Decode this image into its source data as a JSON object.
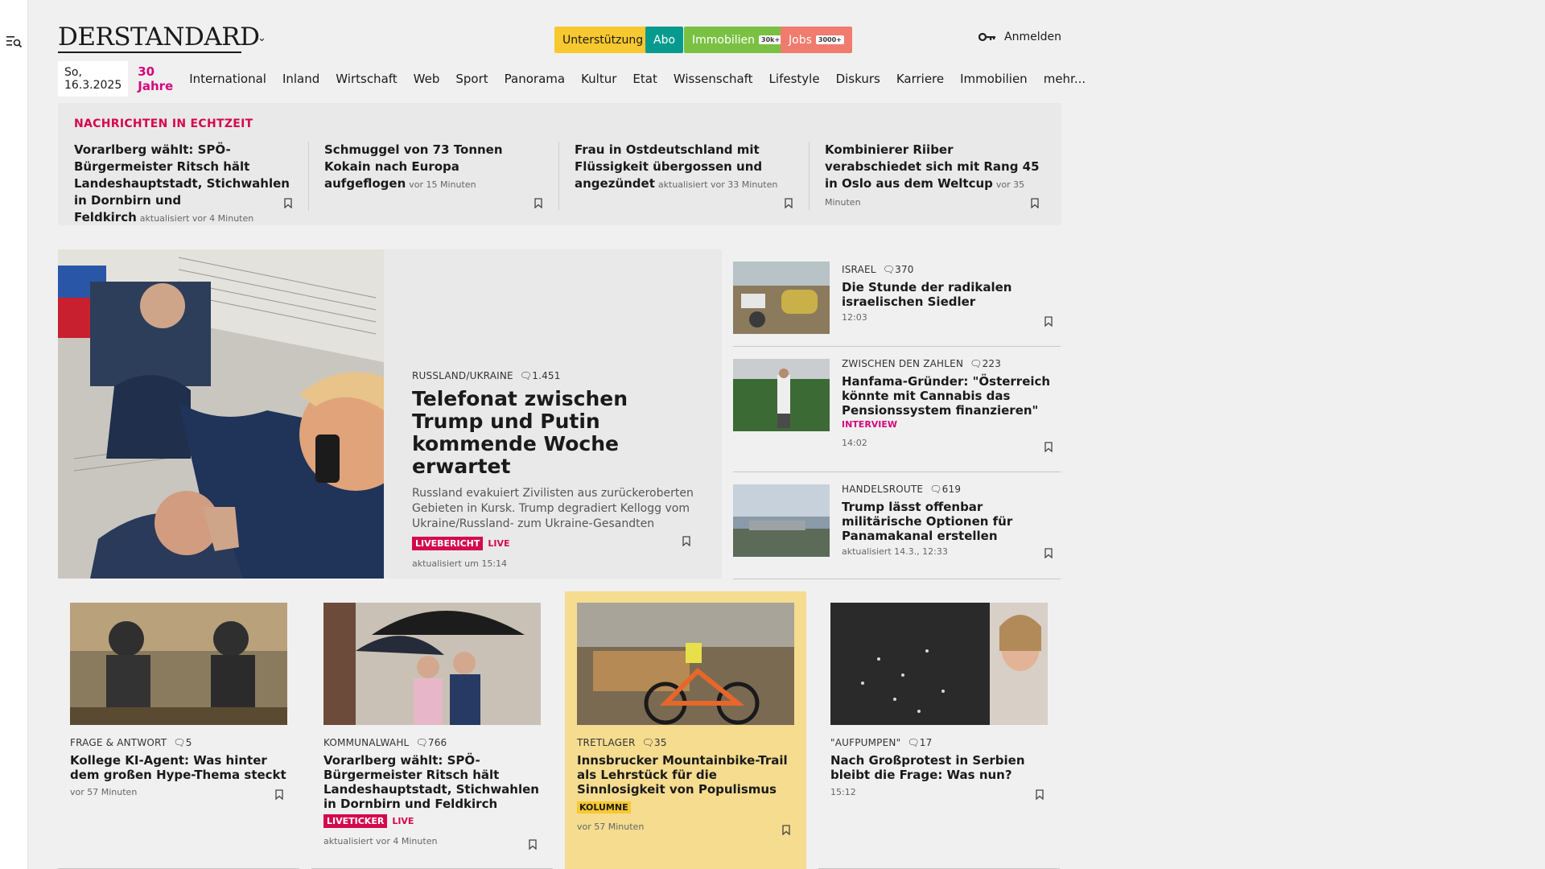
{
  "header": {
    "logo": "DERSTANDARD",
    "promos": [
      {
        "label": "Unterstützung",
        "badge": "",
        "bg": "#f7c82f",
        "fg": "#1a1a1a"
      },
      {
        "label": "Abo",
        "badge": "",
        "bg": "#069a8e",
        "fg": "#ffffff"
      },
      {
        "label": "Immobilien",
        "badge": "30k+",
        "bg": "#7ac143",
        "fg": "#ffffff"
      },
      {
        "label": "Jobs",
        "badge": "3000+",
        "bg": "#f07b6e",
        "fg": "#ffffff"
      }
    ],
    "login": "Anmelden"
  },
  "nav": {
    "date": "So, 16.3.2025",
    "items": [
      "30 Jahre",
      "International",
      "Inland",
      "Wirtschaft",
      "Web",
      "Sport",
      "Panorama",
      "Kultur",
      "Etat",
      "Wissenschaft",
      "Lifestyle",
      "Diskurs",
      "Karriere",
      "Immobilien",
      "mehr..."
    ]
  },
  "ticker": {
    "title": "NACHRICHTEN IN ECHTZEIT",
    "items": [
      {
        "title": "Vorarlberg wählt: SPÖ-Bürgermeister Ritsch hält Landeshauptstadt, Stichwahlen in Dornbirn und Feldkirch",
        "meta": "aktualisiert vor 4 Minuten"
      },
      {
        "title": "Schmuggel von 73 Tonnen Kokain nach Europa aufgeflogen",
        "meta": "vor 15 Minuten"
      },
      {
        "title": "Frau in Ostdeutschland mit Flüssigkeit übergossen und angezündet",
        "meta": "aktualisiert vor 33 Minuten"
      },
      {
        "title": "Kombinierer Riiber verabschiedet sich mit Rang 45 in Oslo aus dem Weltcup",
        "meta": "vor 35 Minuten"
      }
    ]
  },
  "lead": {
    "kicker": "RUSSLAND/UKRAINE",
    "comments": "1.451",
    "title": "Telefonat zwischen Trump und Putin kommende Woche erwartet",
    "summary": "Russland evakuiert Zivilisten aus zurückeroberten Gebieten in Kursk. Trump degradiert Kellogg vom Ukraine/Russland- zum Ukraine-Gesandten",
    "tag": "LIVEBERICHT",
    "live": "LIVE",
    "time": "aktualisiert um 15:14"
  },
  "side": [
    {
      "kicker": "ISRAEL",
      "comments": "370",
      "title": "Die Stunde der radikalen israelischen Siedler",
      "extra": "",
      "time": "12:03"
    },
    {
      "kicker": "ZWISCHEN DEN ZAHLEN",
      "comments": "223",
      "title": "Hanfama-Gründer: \"Österreich könnte mit Cannabis das Pensionssystem finanzieren\"",
      "extra": "INTERVIEW",
      "time": "14:02"
    },
    {
      "kicker": "HANDELSROUTE",
      "comments": "619",
      "title": "Trump lässt offenbar militärische Optionen für Panamakanal erstellen",
      "extra": "",
      "time": "aktualisiert 14.3., 12:33"
    }
  ],
  "cards": [
    {
      "kicker": "FRAGE & ANTWORT",
      "comments": "5",
      "title": "Kollege KI-Agent: Was hinter dem großen Hype-Thema steckt",
      "tag": "",
      "live": "",
      "kolumne": "",
      "time": "vor 57 Minuten"
    },
    {
      "kicker": "KOMMUNALWAHL",
      "comments": "766",
      "title": "Vorarlberg wählt: SPÖ-Bürgermeister Ritsch hält Landeshauptstadt, Stichwahlen in Dornbirn und Feldkirch",
      "tag": "LIVETICKER",
      "live": "LIVE",
      "kolumne": "",
      "time": "aktualisiert vor 4 Minuten"
    },
    {
      "kicker": "TRETLAGER",
      "comments": "35",
      "title": "Innsbrucker Mountainbike-Trail als Lehrstück für die Sinnlosigkeit von Populismus",
      "tag": "",
      "live": "",
      "kolumne": "KOLUMNE",
      "time": "vor 57 Minuten"
    },
    {
      "kicker": "\"AUFPUMPEN\"",
      "comments": "17",
      "title": "Nach Großprotest in Serbien bleibt die Frage: Was nun?",
      "tag": "",
      "live": "",
      "kolumne": "",
      "time": "15:12"
    }
  ]
}
